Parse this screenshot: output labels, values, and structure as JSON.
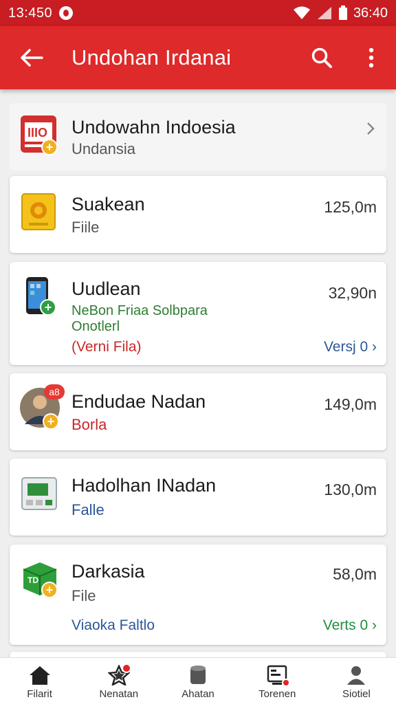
{
  "status_bar": {
    "time_left": "13:450",
    "time_right": "36:40"
  },
  "app_bar": {
    "title": "Undohan Irdanai"
  },
  "header_item": {
    "title": "Undowahn Indoesia",
    "subtitle": "Undansia"
  },
  "items": [
    {
      "title": "Suakean",
      "subtitle": "Fiile",
      "size": "125,0m"
    },
    {
      "title": "Uudlean",
      "description": "NeBon Friaa Solbpara Onotlerl",
      "status": "(Verni Fila)",
      "size": "32,90n",
      "version": "Versj 0",
      "version_color": "#2b5797"
    },
    {
      "title": "Endudae Nadan",
      "subtitle": "Borla",
      "size": "149,0m",
      "avatar_badge": "a8"
    },
    {
      "title": "Hadolhan INadan",
      "subtitle": "Falle",
      "size": "130,0m"
    },
    {
      "title": "Darkasia",
      "subtitle": "File",
      "size": "58,0m",
      "footer": "Viaoka Faltlo",
      "version": "Verts 0",
      "version_color": "#1e8e3e"
    }
  ],
  "bottom_nav": [
    {
      "label": "Filarit",
      "icon": "home-icon"
    },
    {
      "label": "Nenatan",
      "icon": "star-icon"
    },
    {
      "label": "Ahatan",
      "icon": "database-icon"
    },
    {
      "label": "Torenen",
      "icon": "monitor-icon"
    },
    {
      "label": "Siotiel",
      "icon": "person-icon"
    }
  ],
  "colors": {
    "primary": "#de2a2a",
    "status_bar": "#c81d22",
    "accent_badge": "#f2b01e",
    "red_text": "#c62828",
    "blue_text": "#2b5797",
    "green_text": "#1e8e3e"
  }
}
